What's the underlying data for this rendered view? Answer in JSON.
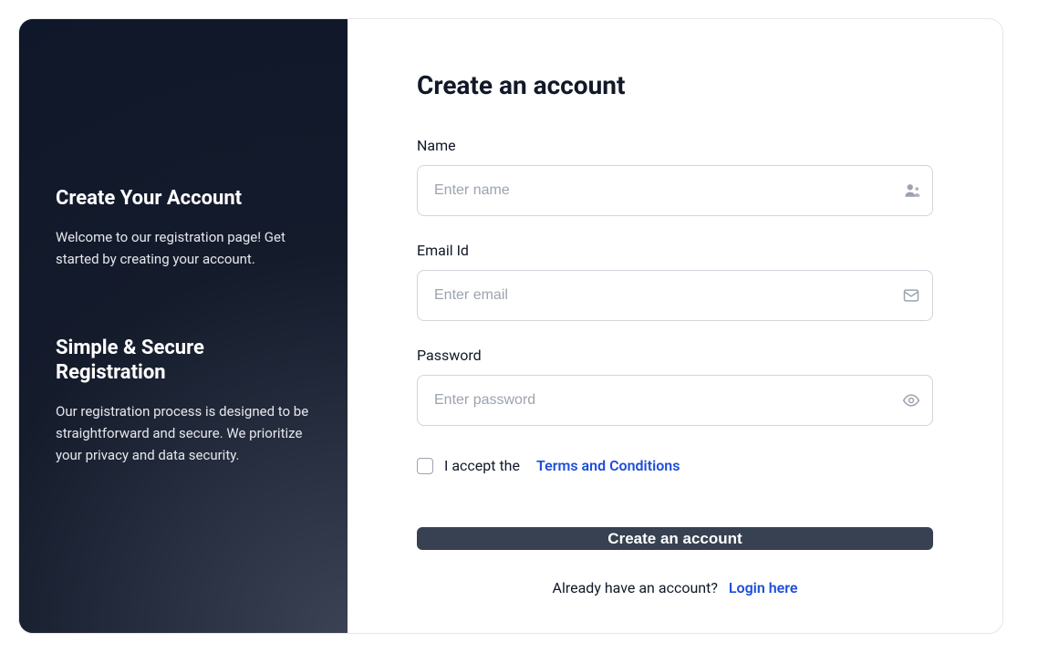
{
  "sidebar": {
    "blocks": [
      {
        "heading": "Create Your Account",
        "body": "Welcome to our registration page! Get started by creating your account."
      },
      {
        "heading": "Simple & Secure Registration",
        "body": "Our registration process is designed to be straightforward and secure. We prioritize your privacy and data security."
      }
    ]
  },
  "main": {
    "title": "Create an account",
    "fields": {
      "name": {
        "label": "Name",
        "placeholder": "Enter name"
      },
      "email": {
        "label": "Email Id",
        "placeholder": "Enter email"
      },
      "password": {
        "label": "Password",
        "placeholder": "Enter password"
      }
    },
    "terms": {
      "text": "I accept the",
      "link": "Terms and Conditions"
    },
    "submit": "Create an account",
    "footer": {
      "text": "Already have an account?",
      "link": "Login here"
    }
  }
}
